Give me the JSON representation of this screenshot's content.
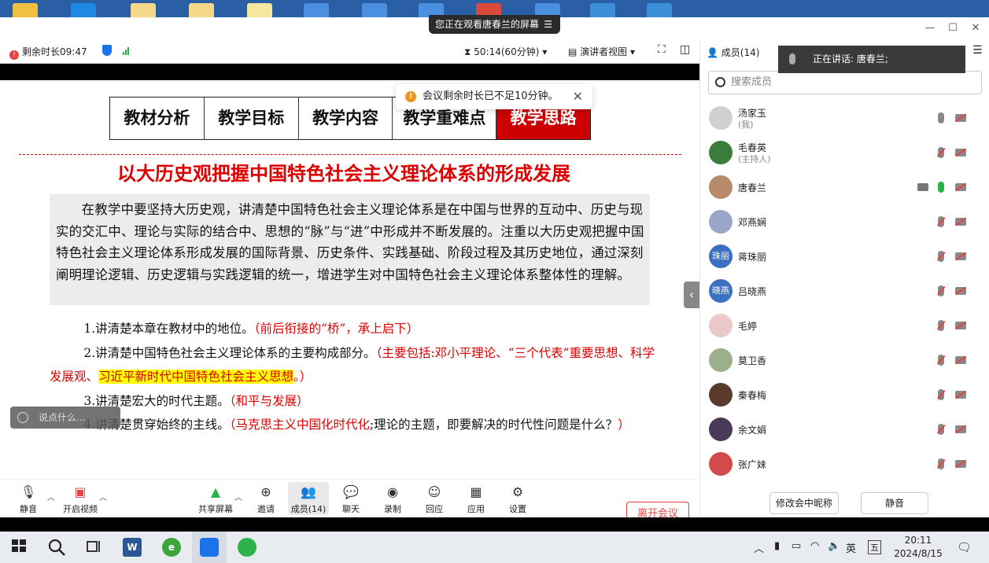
{
  "share_tip": "您正在观看唐春兰的屏幕",
  "toolbar": {
    "remaining": "剩余时长09:47",
    "timer": "50:14(60分钟)",
    "presenter_view": "演讲者视图"
  },
  "members_header": "成员(14)",
  "speaking": "正在讲话:  唐春兰;",
  "search_placeholder": "搜索成员",
  "notice": "会议剩余时长已不足10分钟。",
  "slide": {
    "tabs": [
      "教材分析",
      "教学目标",
      "教学内容",
      "教学重难点",
      "教学思路"
    ],
    "headline": "以大历史观把握中国特色社会主义理论体系的形成发展",
    "paragraph": "在教学中要坚持大历史观，讲清楚中国特色社会主义理论体系是在中国与世界的互动中、历史与现实的交汇中、理论与实际的结合中、思想的“脉”与“进”中形成并不断发展的。注重以大历史观把握中国特色社会主义理论体系形成发展的国际背景、历史条件、实践基础、阶段过程及其历史地位，通过深刻阐明理论逻辑、历史逻辑与实践逻辑的统一，增进学生对中国特色社会主义理论体系整体性的理解。",
    "item1_text": "1.讲清楚本章在教材中的地位。",
    "item1_red": "（前后衔接的“桥”，承上启下）",
    "item2_text": "2.讲清楚中国特色社会主义理论体系的主要构成部分。",
    "item2_red": "（主要包括:邓小平理论、“三个代表”重要思想、科学发展观、",
    "item2_hl": "习近平新时代中国特色社会主义思想",
    "item2_end": "。）",
    "item3_text": "3.讲清楚宏大的时代主题。",
    "item3_red": "（和平与发展）",
    "item4_text": "4.讲清楚贯穿始终的主线。",
    "item4_red": "（马克思主义中国化时代化",
    "item4_rest": ";理论的主题，即要解决的时代性问题是什么？",
    "item4_end": "）"
  },
  "chat_placeholder": "说点什么...",
  "controls": {
    "mute": "静音",
    "video": "开启视频",
    "share": "共享屏幕",
    "invite": "邀请",
    "members": "成员(14)",
    "chat": "聊天",
    "record": "录制",
    "replay": "回应",
    "apps": "应用",
    "settings": "设置",
    "leave": "离开会议"
  },
  "members": [
    {
      "name": "汤家玉",
      "role": "(我)",
      "color": "#d0d0d0",
      "initials": "",
      "mic": "on-gray"
    },
    {
      "name": "毛春英",
      "role": "(主持人)",
      "color": "#3a7d3a",
      "initials": "",
      "mic": "off"
    },
    {
      "name": "唐春兰",
      "role": "",
      "color": "#b78a6a",
      "initials": "",
      "mic": "on"
    },
    {
      "name": "邓燕娴",
      "role": "",
      "color": "#9aa6c8",
      "initials": "",
      "mic": "off"
    },
    {
      "name": "蒋珠丽",
      "role": "",
      "color": "#3b6fc2",
      "initials": "珠丽",
      "mic": "off"
    },
    {
      "name": "吕晓燕",
      "role": "",
      "color": "#3b6fc2",
      "initials": "晓燕",
      "mic": "off"
    },
    {
      "name": "毛婷",
      "role": "",
      "color": "#e9c9c9",
      "initials": "",
      "mic": "off"
    },
    {
      "name": "莫卫香",
      "role": "",
      "color": "#9bb08a",
      "initials": "",
      "mic": "off"
    },
    {
      "name": "秦春梅",
      "role": "",
      "color": "#5a3a2a",
      "initials": "",
      "mic": "off"
    },
    {
      "name": "余文娟",
      "role": "",
      "color": "#4a3a5a",
      "initials": "",
      "mic": "off"
    },
    {
      "name": "张广妹",
      "role": "",
      "color": "#d34a4a",
      "initials": "",
      "mic": "off"
    }
  ],
  "side_footer": {
    "rename": "修改会中昵称",
    "mute": "静音"
  },
  "taskbar": {
    "ime": "英",
    "ime2": "五",
    "time": "20:11",
    "date": "2024/8/15"
  },
  "colors": {
    "accent_red": "#cc0000",
    "brand_blue": "#1a73e8",
    "warn_orange": "#f0951a",
    "leave_red": "#e64340"
  }
}
